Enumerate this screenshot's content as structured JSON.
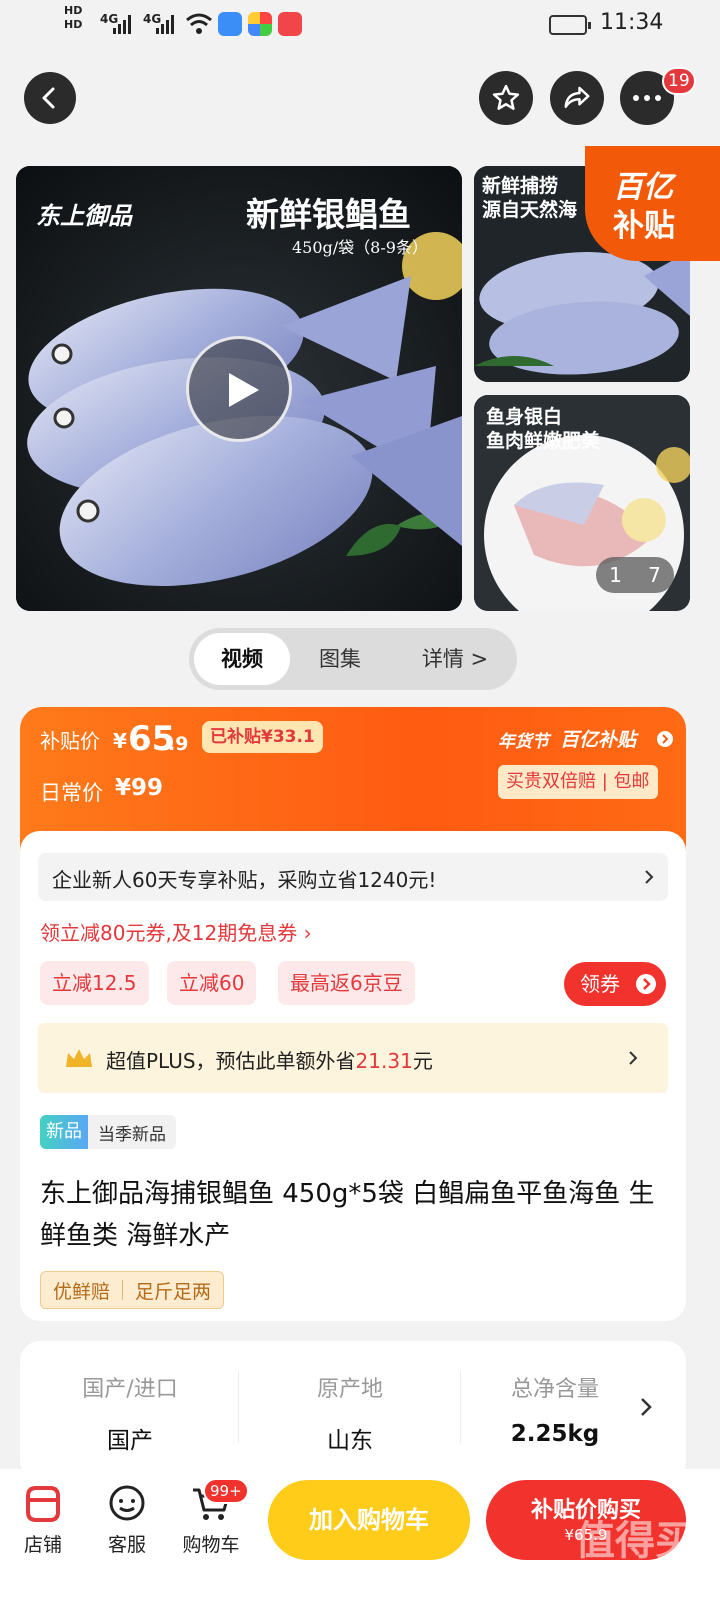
{
  "status_bar": {
    "hd1": "HD",
    "hd2": "HD",
    "signal1": "4G",
    "signal2": "4G",
    "time": "11:34"
  },
  "top_actions": {
    "more_badge": "19"
  },
  "media": {
    "brand_logo": "东上御品",
    "hero_title": "新鲜银鲳鱼",
    "hero_sub": "450g/袋（8-9条）",
    "thumb1_line1": "新鲜捕捞",
    "thumb1_line2": "源自天然海",
    "thumb2_line1": "鱼身银白",
    "thumb2_line2": "鱼肉鲜嫩肥美",
    "subsidy_tag_line1": "百亿",
    "subsidy_tag_line2": "补贴",
    "counter_current": "1",
    "counter_total": "7"
  },
  "tabs": [
    "视频",
    "图集",
    "详情 >"
  ],
  "price": {
    "subsidy_label": "补贴价",
    "currency": "¥",
    "subsidy_int": "65",
    "subsidy_dec": ".9",
    "already_subsidy": "已补贴¥33.1",
    "normal_label": "日常价",
    "normal_price": "¥99",
    "brand_festival": "年货节",
    "brand_subsidy": "百亿补贴",
    "guarantee": "买贵双倍赔 | 包邮"
  },
  "promos": {
    "enterprise": "企业新人60天专享补贴，采购立省1240元!",
    "coupon_line": "领立减80元券,及12期免息券 ›",
    "chips": [
      "立减12.5",
      "立减60",
      "最高返6京豆"
    ],
    "get_coupon": "领券",
    "plus_prefix": "超值PLUS，预估此单额外省",
    "plus_amount": "21.31",
    "plus_suffix": "元"
  },
  "product": {
    "new_tag": "新品",
    "new_desc": "当季新品",
    "title": "东上御品海捕银鲳鱼 450g*5袋 白鲳扁鱼平鱼海鱼 生鲜鱼类 海鲜水产",
    "service1": "优鲜赔",
    "service2": "足斤足两"
  },
  "specs": [
    {
      "label": "国产/进口",
      "value": "国产"
    },
    {
      "label": "原产地",
      "value": "山东"
    },
    {
      "label": "总净含量",
      "value": "2.25kg"
    }
  ],
  "bottom_nav": {
    "store": "店铺",
    "service": "客服",
    "cart": "购物车",
    "cart_badge": "99+",
    "add_cart": "加入购物车",
    "buy": "补贴价购买",
    "buy_price": "¥65.9",
    "watermark": "值得买",
    "watermark_url": "zhizhizhi.com"
  },
  "colors": {
    "accent_orange": "#ff5b12",
    "jd_red": "#e4393c",
    "cart_yellow": "#ffcc1a"
  }
}
